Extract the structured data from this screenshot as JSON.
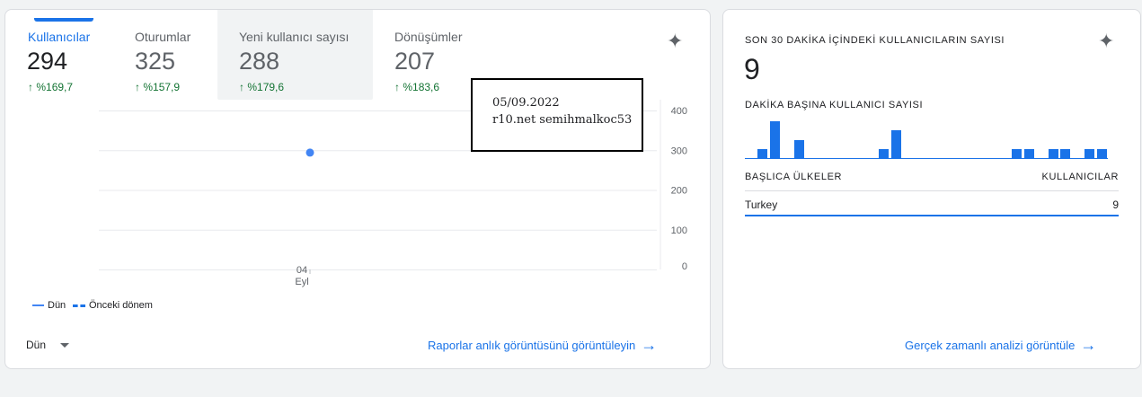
{
  "left_card": {
    "metrics": [
      {
        "title": "Kullanıcılar",
        "value": "294",
        "change": "%169,7",
        "active": true
      },
      {
        "title": "Oturumlar",
        "value": "325",
        "change": "%157,9",
        "active": false
      },
      {
        "title": "Yeni kullanıcı sayısı",
        "value": "288",
        "change": "%179,6",
        "active": false,
        "hovered": true
      },
      {
        "title": "Dönüşümler",
        "value": "207",
        "change": "%183,6",
        "active": false
      }
    ],
    "change_arrow": "↑",
    "sparkle_icon": "✦",
    "tooltip": {
      "line1": "05/09.2022",
      "line2": "r10.net semihmalkoc53"
    },
    "x_tick": {
      "day": "04",
      "month": "Eyl"
    },
    "legend": {
      "current": "Dün",
      "previous": "Önceki dönem"
    },
    "dropdown_value": "Dün",
    "report_link": "Raporlar anlık görüntüsünü görüntüleyin",
    "arrow_icon": "→"
  },
  "chart_data": {
    "type": "line",
    "x": [
      "04 Eyl"
    ],
    "series": [
      {
        "name": "Dün",
        "values": [
          294
        ]
      }
    ],
    "y_ticks": [
      400,
      300,
      200,
      100,
      0
    ],
    "ylim": [
      0,
      400
    ],
    "grid": true,
    "legend_placement": "bottom-left",
    "colors": {
      "current": "#4285f4",
      "previous": "#1a73e8"
    }
  },
  "right_card": {
    "heading": "SON 30 DAKİKA İÇİNDEKİ KULLANICILARIN SAYISI",
    "count": "9",
    "per_minute_heading": "DAKİKA BAŞINA KULLANICI SAYISI",
    "per_minute_values": [
      0,
      1,
      4,
      0,
      2,
      0,
      0,
      0,
      0,
      0,
      0,
      1,
      3,
      0,
      0,
      0,
      0,
      0,
      0,
      0,
      0,
      0,
      1,
      1,
      0,
      1,
      1,
      0,
      1,
      1
    ],
    "table": {
      "col1": "BAŞLICA ÜLKELER",
      "col2": "KULLANICILAR",
      "rows": [
        {
          "country": "Turkey",
          "users": "9"
        }
      ]
    },
    "realtime_link": "Gerçek zamanlı analizi görüntüle"
  }
}
